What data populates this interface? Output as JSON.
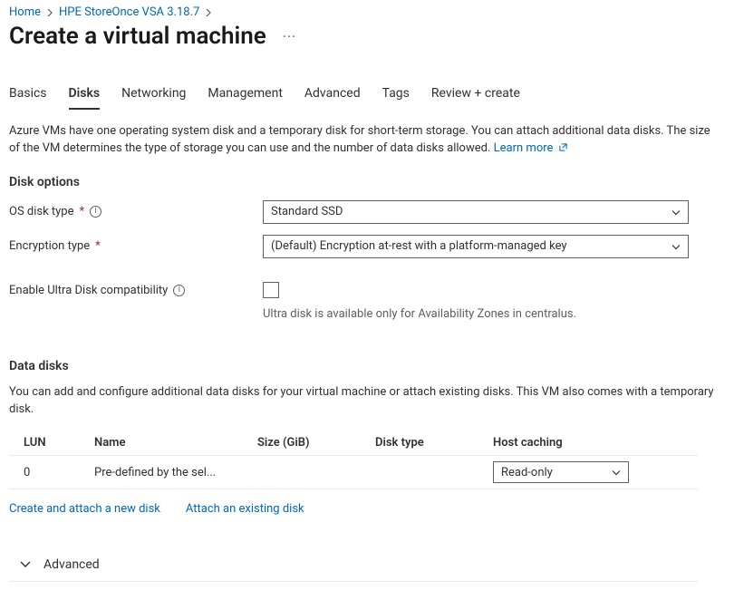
{
  "breadcrumb": {
    "home": "Home",
    "product": "HPE StoreOnce VSA 3.18.7"
  },
  "page_title": "Create a virtual machine",
  "tabs": {
    "basics": "Basics",
    "disks": "Disks",
    "networking": "Networking",
    "management": "Management",
    "advanced": "Advanced",
    "tags": "Tags",
    "review": "Review + create"
  },
  "intro": {
    "text": "Azure VMs have one operating system disk and a temporary disk for short-term storage. You can attach additional data disks. The size of the VM determines the type of storage you can use and the number of data disks allowed.",
    "learn_more": "Learn more"
  },
  "disk_options": {
    "title": "Disk options",
    "os_disk_type_label": "OS disk type",
    "os_disk_type_value": "Standard SSD",
    "encryption_label": "Encryption type",
    "encryption_value": "(Default) Encryption at-rest with a platform-managed key",
    "ultra_label": "Enable Ultra Disk compatibility",
    "ultra_hint": "Ultra disk is available only for Availability Zones in centralus."
  },
  "data_disks": {
    "title": "Data disks",
    "descr": "You can add and configure additional data disks for your virtual machine or attach existing disks. This VM also comes with a temporary disk.",
    "cols": {
      "lun": "LUN",
      "name": "Name",
      "size": "Size (GiB)",
      "disk_type": "Disk type",
      "host_caching": "Host caching"
    },
    "rows": [
      {
        "lun": "0",
        "name": "Pre-defined by the sel...",
        "size": "",
        "disk_type": "",
        "host_caching": "Read-only"
      }
    ],
    "link_create": "Create and attach a new disk",
    "link_attach": "Attach an existing disk"
  },
  "advanced_section": {
    "label": "Advanced"
  }
}
